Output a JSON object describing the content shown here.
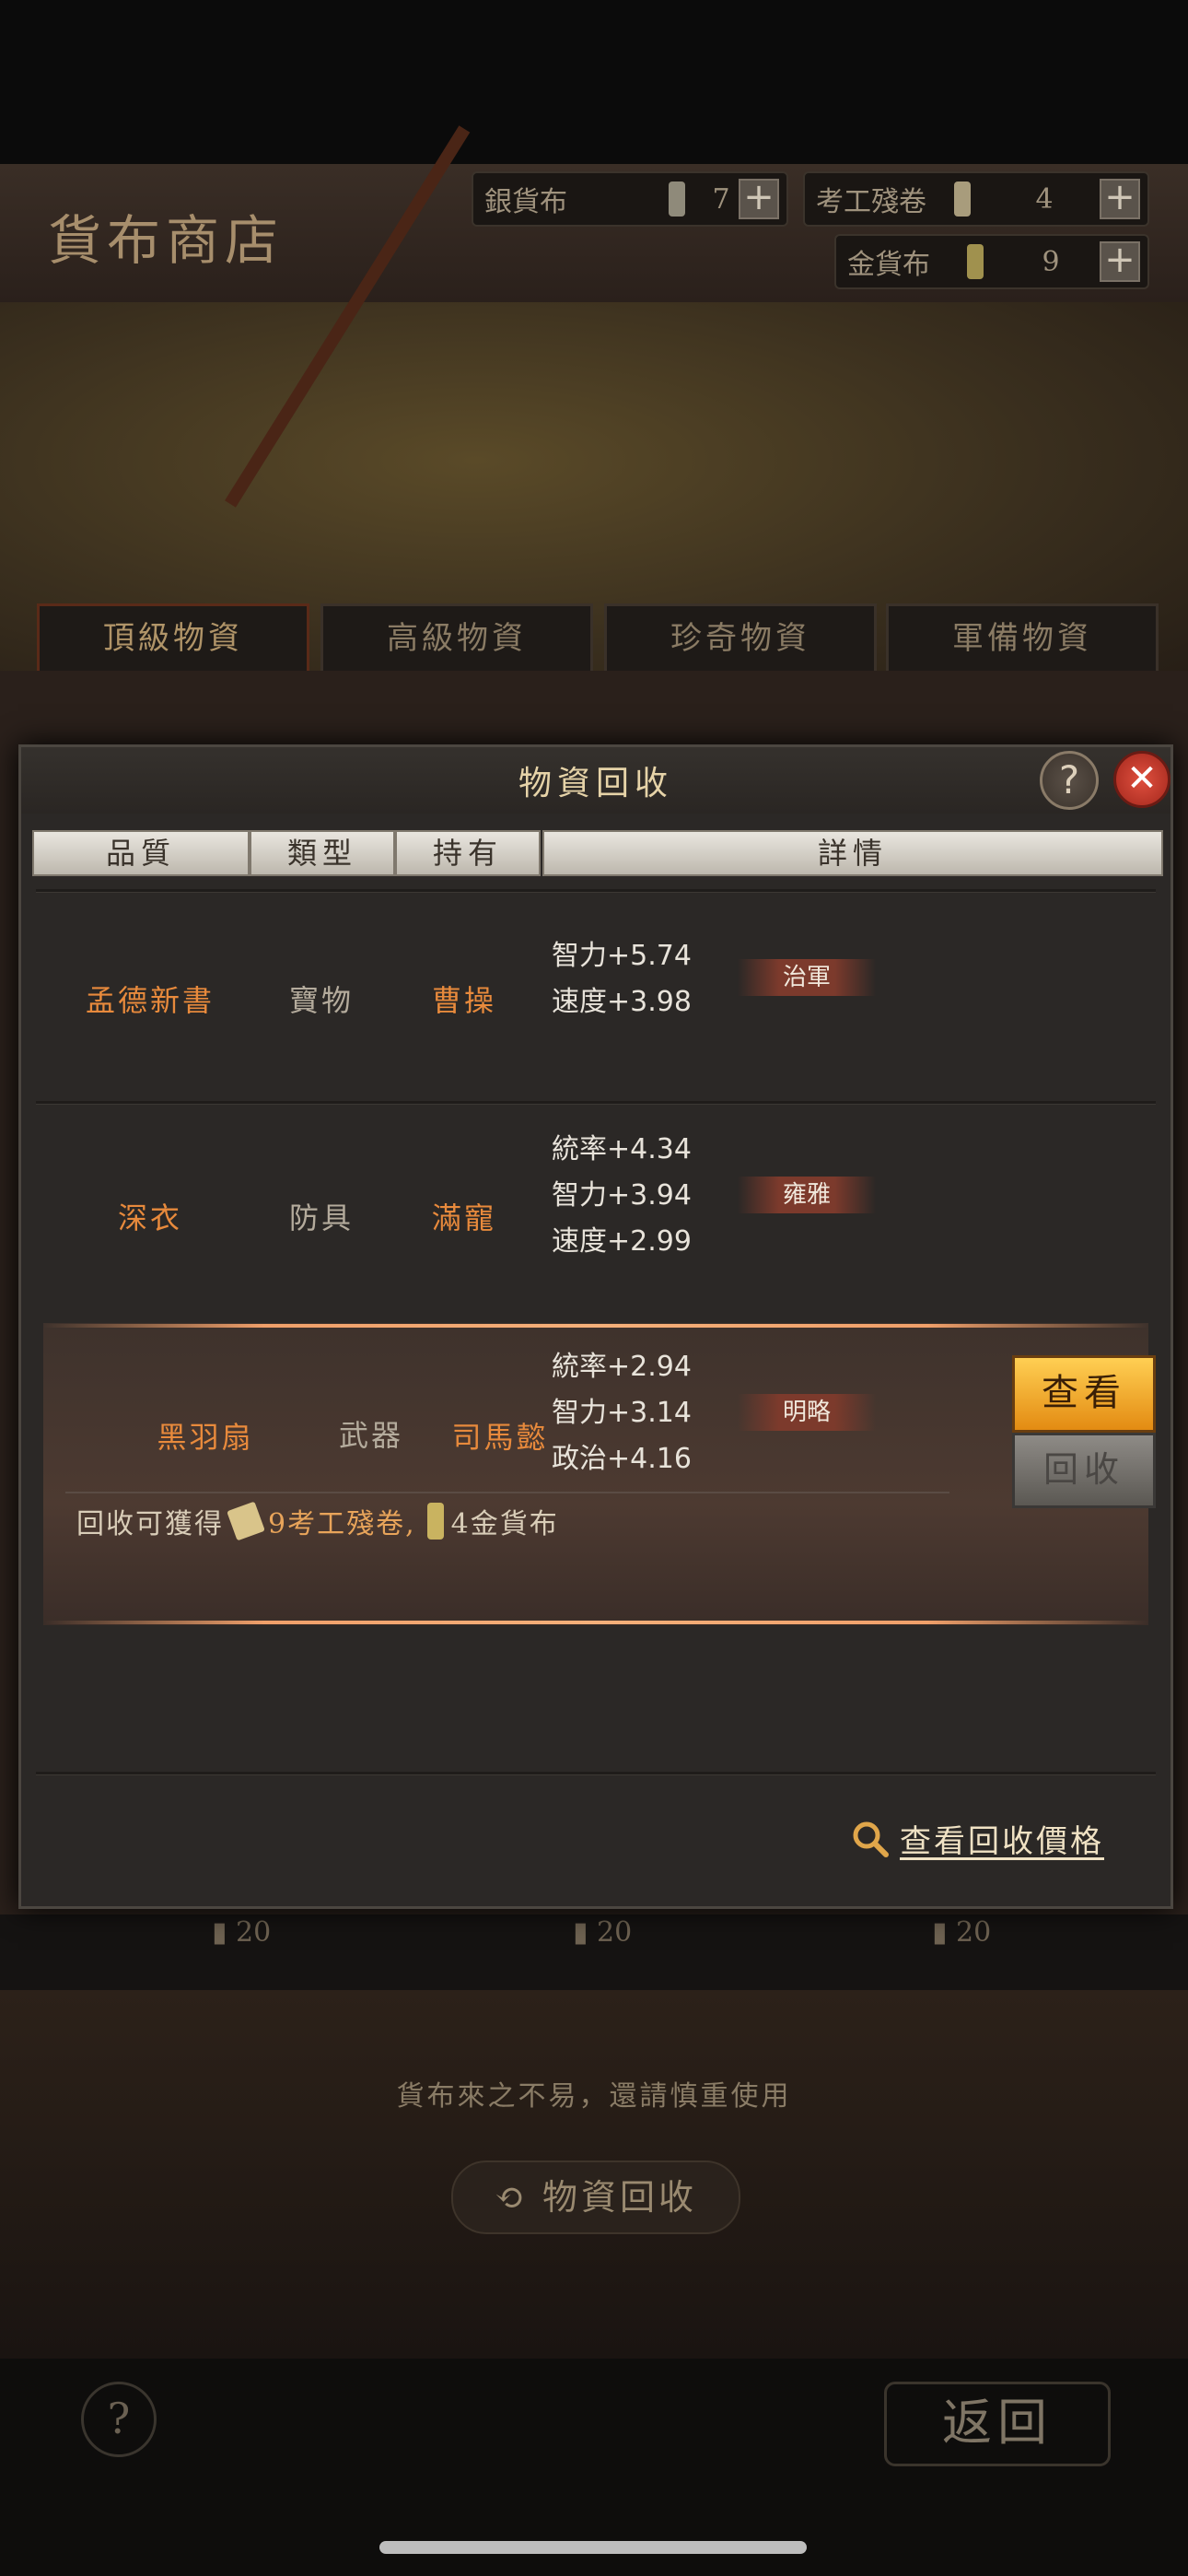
{
  "shop": {
    "title": "貨布商店",
    "currencies": [
      {
        "label": "銀貨布",
        "value": "7"
      },
      {
        "label": "考工殘卷",
        "value": "4"
      },
      {
        "label": "金貨布",
        "value": "9"
      }
    ],
    "tabs": [
      "頂級物資",
      "高級物資",
      "珍奇物資",
      "軍備物資"
    ],
    "costs": [
      "20",
      "20",
      "20"
    ],
    "note": "貨布來之不易，還請慎重使用",
    "recycle_button": "物資回收",
    "help": "?",
    "back": "返回"
  },
  "modal": {
    "title": "物資回收",
    "help": "?",
    "close": "✕",
    "columns": [
      "品質",
      "類型",
      "持有",
      "詳情"
    ],
    "rows": [
      {
        "name": "孟德新書",
        "type": "寶物",
        "owner": "曹操",
        "stats": [
          "智力+5.74",
          "速度+3.98"
        ],
        "trait": "治軍"
      },
      {
        "name": "深衣",
        "type": "防具",
        "owner": "滿寵",
        "stats": [
          "統率+4.34",
          "智力+3.94",
          "速度+2.99"
        ],
        "trait": "雍雅"
      },
      {
        "name": "黑羽扇",
        "type": "武器",
        "owner": "司馬懿",
        "stats": [
          "統率+2.94",
          "智力+3.14",
          "政治+4.16"
        ],
        "trait": "明略"
      }
    ],
    "reward": {
      "prefix": "回收可獲得",
      "part1": "9考工殘卷,",
      "part2": "4金貨布"
    },
    "view_button": "查看",
    "recycle_button": "回收",
    "price_link": "查看回收價格"
  },
  "colors": {
    "accent_orange": "#e88a3c",
    "view_button": "#f5a623",
    "close_red": "#c0392b"
  }
}
